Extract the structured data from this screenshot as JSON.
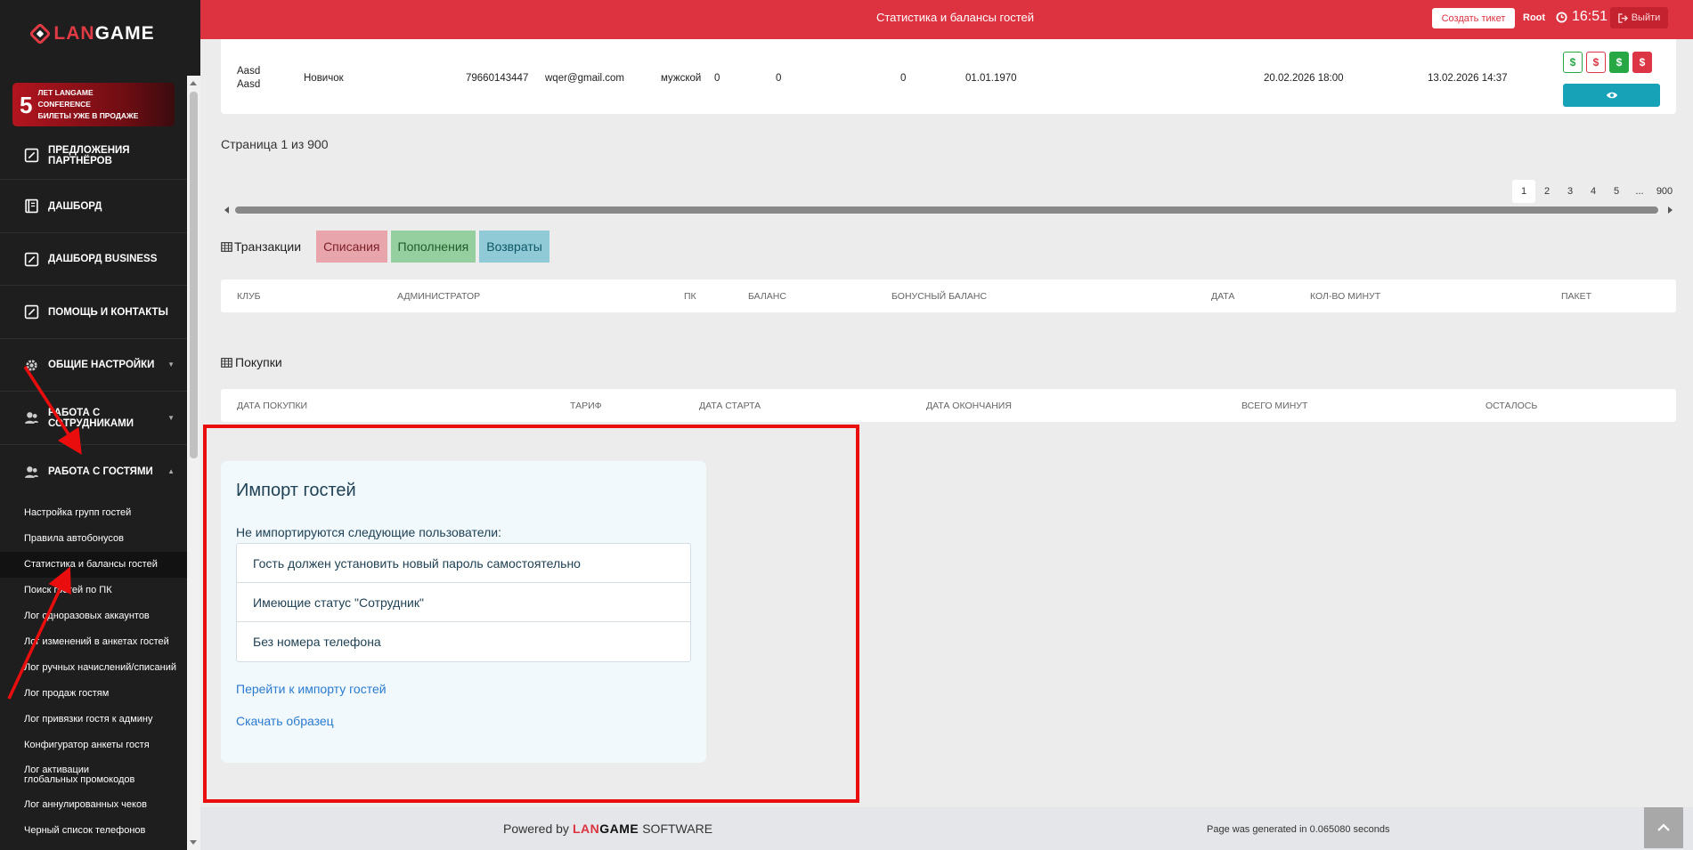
{
  "brand": {
    "part1": "LAN",
    "part2": "GAME"
  },
  "promo": {
    "number": "5",
    "lines": [
      "ЛЕТ LANGAME",
      "CONFERENCE",
      "БИЛЕТЫ УЖЕ В ПРОДАЖЕ"
    ]
  },
  "menu": [
    {
      "label": "ПРЕДЛОЖЕНИЯ ПАРТНЁРОВ",
      "icon": "edit-icon"
    },
    {
      "label": "ДАШБОРД",
      "icon": "book-icon"
    },
    {
      "label": "ДАШБОРД BUSINESS",
      "icon": "edit-icon"
    },
    {
      "label": "ПОМОЩЬ И КОНТАКТЫ",
      "icon": "edit-icon"
    },
    {
      "label": "ОБЩИЕ НАСТРОЙКИ",
      "icon": "gear-icon"
    },
    {
      "label": "РАБОТА С СОТРУДНИКАМИ",
      "icon": "users-icon"
    },
    {
      "label": "РАБОТА С ГОСТЯМИ",
      "icon": "users-icon"
    }
  ],
  "submenu": [
    "Настройка групп гостей",
    "Правила автобонусов",
    "Статистика и балансы гостей",
    "Поиск гостей по ПК",
    "Лог одноразовых аккаунтов",
    "Лог изменений в анкетах гостей",
    "Лог ручных начислений/списаний",
    "Лог продаж гостям",
    "Лог привязки гостя к админу",
    "Конфигуратор анкеты гостя",
    "Лог активации глобальных промокодов",
    "Лог аннулированных чеков",
    "Черный список телефонов"
  ],
  "topbar": {
    "title": "Статистика и балансы гостей",
    "ticket_label": "Создать тикет",
    "user": "Root",
    "time": "16:51",
    "logout_label": "Выйти"
  },
  "guest": {
    "name1": "Aasd",
    "name2": "Aasd",
    "group": "Новичок",
    "phone": "79660143447",
    "email": "wqer@gmail.com",
    "gender": "мужской",
    "v1": "0",
    "v2": "0",
    "v3": "0",
    "birthday": "01.01.1970",
    "date1": "20.02.2026 18:00",
    "date2": "13.02.2026 14:37",
    "money_symbol": "$"
  },
  "pagination": {
    "info": "Страница 1 из 900",
    "pages": [
      "1",
      "2",
      "3",
      "4",
      "5",
      "...",
      "900"
    ]
  },
  "transactions": {
    "label": "Транзакции",
    "tabs": [
      "Списания",
      "Пополнения",
      "Возвраты"
    ],
    "columns": [
      "КЛУБ",
      "АДМИНИСТРАТОР",
      "ПК",
      "БАЛАНС",
      "БОНУСНЫЙ БАЛАНС",
      "ДАТА",
      "КОЛ-ВО МИНУТ",
      "ПАКЕТ"
    ]
  },
  "purchases": {
    "label": "Покупки",
    "columns": [
      "ДАТА ПОКУПКИ",
      "ТАРИФ",
      "ДАТА СТАРТА",
      "ДАТА ОКОНЧАНИЯ",
      "ВСЕГО МИНУТ",
      "ОСТАЛОСЬ"
    ]
  },
  "import": {
    "title": "Импорт гостей",
    "subtitle": "Не импортируются следующие пользователи:",
    "items": [
      "Гость должен установить новый пароль самостоятельно",
      "Имеющие статус \"Сотрудник\"",
      "Без номера телефона"
    ],
    "link_import": "Перейти к импорту гостей",
    "link_sample": "Скачать образец"
  },
  "footer": {
    "powered_prefix": "Powered by",
    "brand1": "LAN",
    "brand2": "GAME",
    "powered_suffix": "SOFTWARE",
    "gen_time": "Page was generated in 0.065080 seconds"
  },
  "colors": {
    "topbar": "#dd3341",
    "sidebar": "#1e1e1e",
    "highlight": "#ea0d0d",
    "link": "#2b7bd0"
  }
}
